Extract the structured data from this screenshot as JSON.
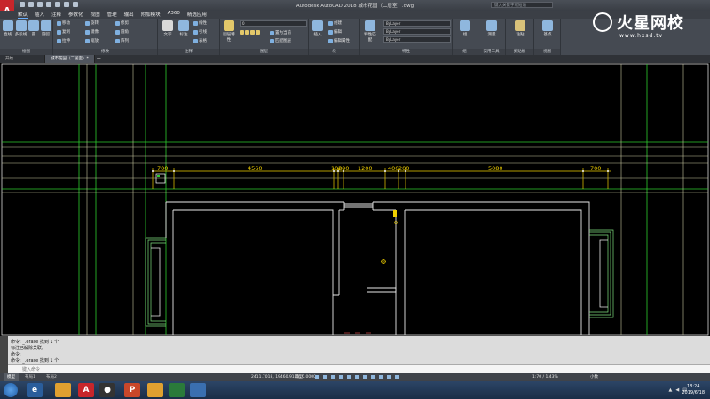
{
  "app": {
    "logo": "A",
    "window_title": "Autodesk AutoCAD 2018    城市花园（二居室）.dwg",
    "search_placeholder": "键入关键字或短语"
  },
  "menu_tabs": [
    "默认",
    "插入",
    "注释",
    "参数化",
    "视图",
    "管理",
    "输出",
    "附加模块",
    "A360",
    "精选应用"
  ],
  "ribbon": {
    "draw_panel": {
      "title": "绘图",
      "tools": [
        "直线",
        "多段线",
        "圆",
        "圆弧"
      ]
    },
    "modify_panel": {
      "title": "修改",
      "tools": [
        "移动",
        "旋转",
        "修剪",
        "复制",
        "镜像",
        "圆角",
        "拉伸",
        "缩放",
        "阵列"
      ]
    },
    "annotation_panel": {
      "title": "注释",
      "tools": [
        "文字",
        "标注",
        "线性",
        "引线",
        "表格"
      ]
    },
    "layers_panel": {
      "title": "图层",
      "big_tool": "图层特性",
      "tools": [
        "置为当前",
        "匹配图层"
      ],
      "layer_combo": "0"
    },
    "block_panel": {
      "title": "块",
      "big_tool": "插入",
      "tools": [
        "创建",
        "编辑",
        "编辑属性"
      ]
    },
    "properties_panel": {
      "title": "特性",
      "big_tool": "特性匹配",
      "combos": [
        "ByLayer",
        "ByLayer",
        "ByLayer"
      ]
    },
    "groups_panel": {
      "title": "组",
      "big_tool": "组"
    },
    "utilities_panel": {
      "title": "实用工具",
      "big_tool": "测量"
    },
    "clipboard_panel": {
      "title": "剪贴板",
      "big_tool": "粘贴"
    },
    "view_panel": {
      "title": "视图",
      "big_tool": "基点"
    }
  },
  "watermark": {
    "title": "火星网校",
    "url": "www.hxsd.tv"
  },
  "doc_tabs": [
    "开始",
    "城市花园（二居室）*"
  ],
  "dimensions": [
    "700",
    "4560",
    "100",
    "200",
    "1200",
    "400",
    "200",
    "5080",
    "700"
  ],
  "command_history": [
    "命令: _.erase 找到 1 个",
    "标注已解除关联。",
    "命令:",
    "命令: _.erase 找到 1 个"
  ],
  "command_prompt": "键入命令",
  "layout_tabs": [
    "模型",
    "布局1",
    "布局2"
  ],
  "status": {
    "coordinates": "2411.7018, 19460.9133, 0.0000",
    "mode": "模型",
    "scale": "1:70 / 1.43%",
    "units": "小数"
  },
  "clock": {
    "time": "18:24",
    "date": "2019/6/18"
  },
  "colors": {
    "canvas": "#000000",
    "dimension": "#f0d000",
    "guide_line": "#2ecc2e",
    "wall_line": "#ffffff",
    "ribbon": "#454a52"
  }
}
